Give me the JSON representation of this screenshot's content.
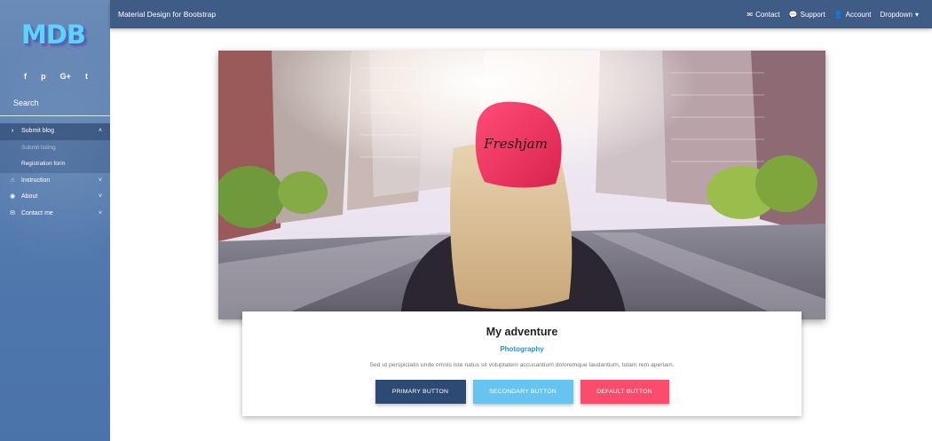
{
  "sidebar": {
    "logo": "MDB",
    "social": [
      "f",
      "p",
      "G+",
      "t"
    ],
    "social_icons": [
      "facebook-icon",
      "pinterest-icon",
      "google-plus-icon",
      "twitter-icon"
    ],
    "search_placeholder": "Search",
    "menu": [
      {
        "label": "Submit blog",
        "icon": "chevron-right-icon",
        "expanded": true
      },
      {
        "label": "Instruction",
        "icon": "hand-pointer-icon"
      },
      {
        "label": "About",
        "icon": "eye-icon"
      },
      {
        "label": "Contact me",
        "icon": "envelope-icon"
      }
    ],
    "submenu": [
      "Submit listing",
      "Registration form"
    ]
  },
  "navbar": {
    "brand": "Material Design for Bootstrap",
    "links": [
      "Contact",
      "Support",
      "Account",
      "Dropdown"
    ]
  },
  "card": {
    "title": "My adventure",
    "subtitle": "Photography",
    "text": "Sed ut perspiciatis unde omnis iste natus sit voluptatem accusantium doloremque laudantium, totam rem aperiam.",
    "hat_text": "Freshjam",
    "buttons": {
      "primary": "PRIMARY BUTTON",
      "secondary": "SECONDARY BUTTON",
      "default": "DEFAULT BUTTON"
    }
  },
  "colors": {
    "navbar": "#3f5c86",
    "sidebar": "#5a7fb0",
    "primary": "#2c4a73",
    "secondary": "#67c4f0",
    "default": "#fc4c6b",
    "subtitle": "#2a8fd8"
  }
}
